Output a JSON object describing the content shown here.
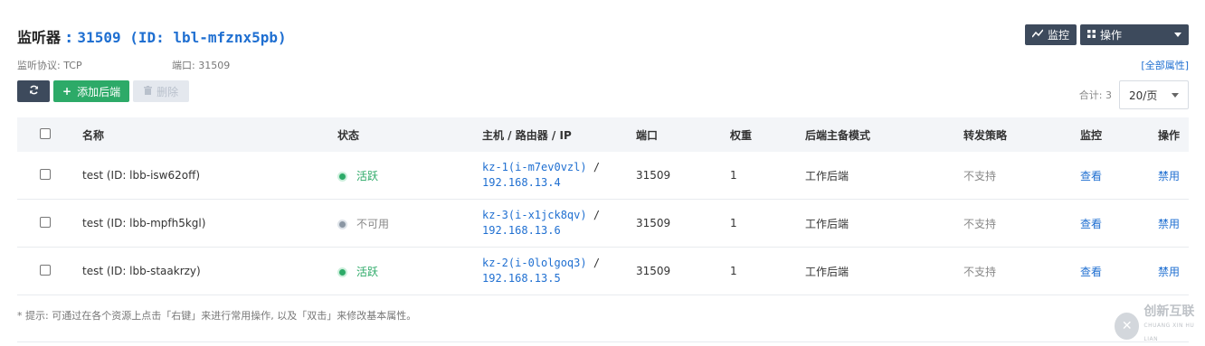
{
  "header": {
    "title_label": "监听器",
    "title_colon": ":",
    "title_id": "31509 (ID: lbl-mfznx5pb)",
    "monitor_button": "监控",
    "operations_button": "操作"
  },
  "meta": {
    "protocol": "监听协议: TCP",
    "port": "端口: 31509",
    "all_attributes_link": "[全部属性]"
  },
  "toolbar": {
    "add_backend": "添加后端",
    "delete": "删除"
  },
  "pager": {
    "total": "合计: 3",
    "page_size": "20/页"
  },
  "table": {
    "columns": [
      "名称",
      "状态",
      "主机 / 路由器 / IP",
      "端口",
      "权重",
      "后端主备模式",
      "转发策略",
      "监控",
      "操作"
    ],
    "rows": [
      {
        "name": "test (ID: lbb-isw62off)",
        "status": "活跃",
        "status_color": "#2daa68",
        "host": "kz-1(i-m7ev0vzl)",
        "ip": "192.168.13.4",
        "port": "31509",
        "weight": "1",
        "mode": "工作后端",
        "policy": "不支持",
        "monitor": "查看",
        "action": "禁用"
      },
      {
        "name": "test (ID: lbb-mpfh5kgl)",
        "status": "不可用",
        "status_color": "#8a96a3",
        "host": "kz-3(i-x1jck8qv)",
        "ip": "192.168.13.6",
        "port": "31509",
        "weight": "1",
        "mode": "工作后端",
        "policy": "不支持",
        "monitor": "查看",
        "action": "禁用"
      },
      {
        "name": "test (ID: lbb-staakrzy)",
        "status": "活跃",
        "status_color": "#2daa68",
        "host": "kz-2(i-0lolgoq3)",
        "ip": "192.168.13.5",
        "port": "31509",
        "weight": "1",
        "mode": "工作后端",
        "policy": "不支持",
        "monitor": "查看",
        "action": "禁用"
      }
    ],
    "host_separator": "/"
  },
  "hint": "* 提示: 可通过在各个资源上点击「右键」来进行常用操作, 以及「双击」来修改基本属性。",
  "watermark": {
    "logo_char": "✕",
    "brand": "创新互联",
    "brand_sub": "CHUANG XIN HU LIAN"
  }
}
